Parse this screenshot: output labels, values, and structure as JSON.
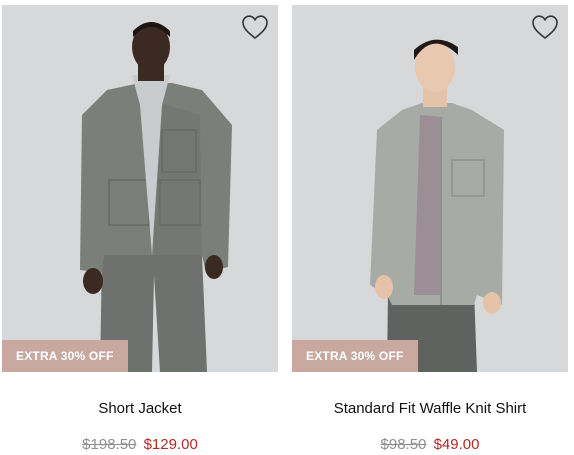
{
  "products": [
    {
      "name": "Short Jacket",
      "badge": "EXTRA 30% OFF",
      "original_price": "$198.50",
      "sale_price": "$129.00",
      "wishlist_icon": "heart-outline-icon"
    },
    {
      "name": "Standard Fit Waffle Knit Shirt",
      "badge": "EXTRA 30% OFF",
      "original_price": "$98.50",
      "sale_price": "$49.00",
      "wishlist_icon": "heart-outline-icon"
    }
  ],
  "colors": {
    "badge_bg": "#c9a8a0",
    "sale_price": "#b22a2a",
    "original_price": "#8e8e8e",
    "photo_bg": "#d7d8da"
  }
}
